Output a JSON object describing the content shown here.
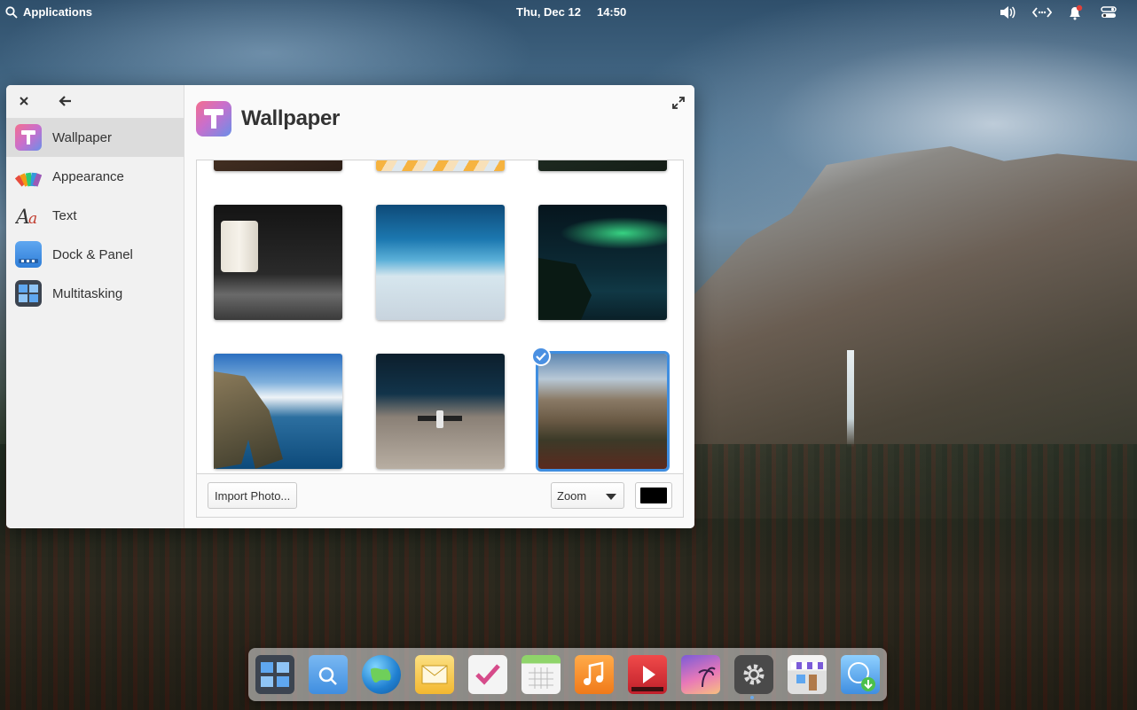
{
  "top_panel": {
    "applications_label": "Applications",
    "date": "Thu, Dec 12",
    "time": "14:50",
    "indicators": [
      "volume-icon",
      "network-icon",
      "notifications-icon",
      "session-icon"
    ]
  },
  "window": {
    "sidebar": {
      "items": [
        {
          "label": "Wallpaper",
          "icon": "wallpaper-icon",
          "active": true
        },
        {
          "label": "Appearance",
          "icon": "appearance-icon",
          "active": false
        },
        {
          "label": "Text",
          "icon": "text-icon",
          "active": false
        },
        {
          "label": "Dock & Panel",
          "icon": "dock-panel-icon",
          "active": false
        },
        {
          "label": "Multitasking",
          "icon": "multitasking-icon",
          "active": false
        }
      ]
    },
    "header": {
      "title": "Wallpaper"
    },
    "gallery": {
      "selected_index": 5,
      "thumbnails": [
        "lantern-photo",
        "ocean-wave-aerial-photo",
        "aurora-sea-arch-photo",
        "coastal-rock-arch-photo",
        "satellite-earth-photo",
        "yosemite-valley-photo"
      ]
    },
    "actions": {
      "import_label": "Import Photo...",
      "zoom_value": "Zoom",
      "background_color": "#000000"
    }
  },
  "dock": {
    "items": [
      "multitasking-view-icon",
      "files-icon",
      "web-browser-icon",
      "mail-icon",
      "tasks-icon",
      "calendar-icon",
      "music-icon",
      "videos-icon",
      "photos-icon",
      "system-settings-icon",
      "appcenter-icon",
      "installer-icon"
    ]
  },
  "colors": {
    "accent": "#3f8ee0",
    "window_bg": "#fafafa",
    "sidebar_bg": "#f1f1f1"
  }
}
